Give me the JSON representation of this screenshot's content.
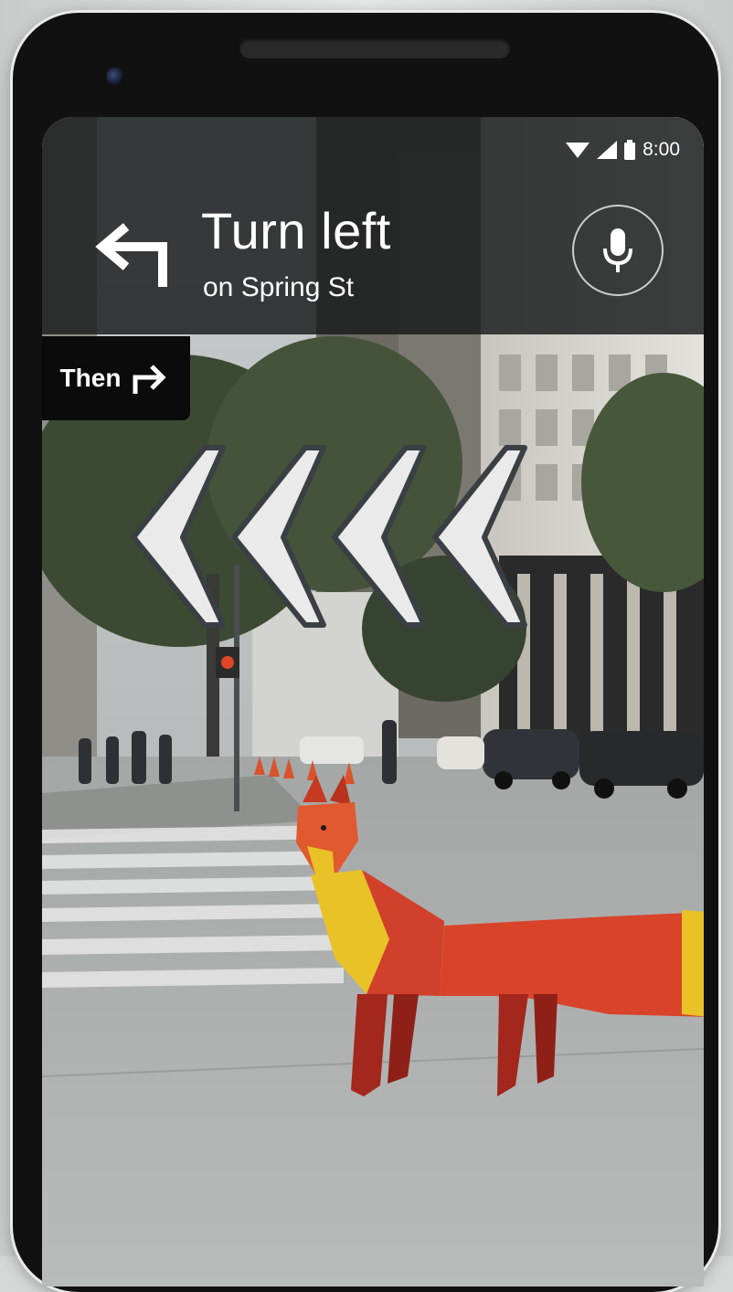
{
  "status_bar": {
    "time": "8:00"
  },
  "navigation": {
    "instruction": "Turn left",
    "street": "on Spring St",
    "then_label": "Then"
  },
  "icons": {
    "turn": "turn-left-arrow-icon",
    "next": "turn-right-arrow-icon",
    "mic": "microphone-icon",
    "ar_guide": "ar-chevron-left-icon",
    "ar_character": "fox-guide"
  },
  "colors": {
    "nav_bar": "#16181a",
    "then_chip": "#0b0b0b",
    "text": "#ffffff",
    "fox_body": "#d9432a",
    "fox_accent": "#e8c227"
  }
}
